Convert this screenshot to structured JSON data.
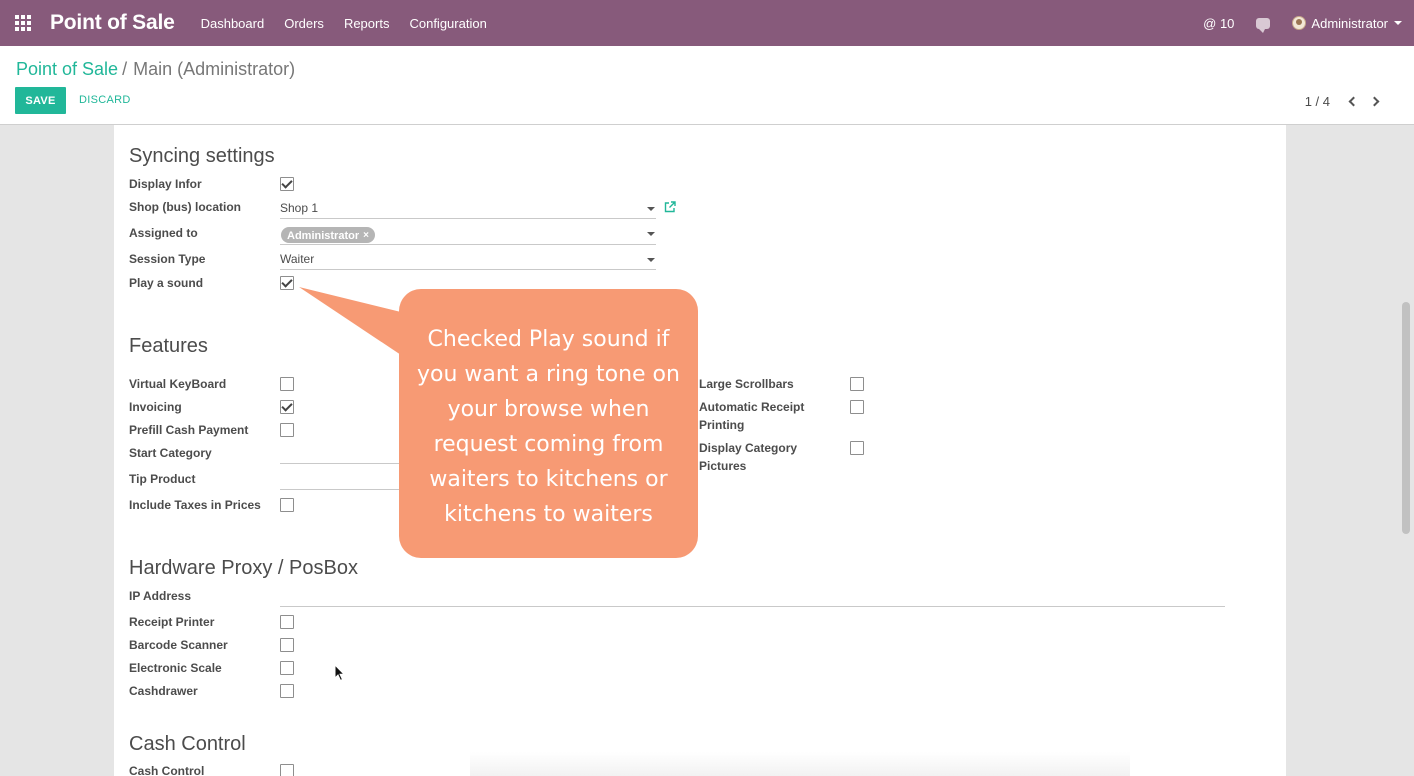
{
  "navbar": {
    "app_title": "Point of Sale",
    "menu": [
      "Dashboard",
      "Orders",
      "Reports",
      "Configuration"
    ],
    "mentions": "@ 10",
    "user": "Administrator",
    "color": "#875a7b"
  },
  "control_panel": {
    "breadcrumb_root": "Point of Sale",
    "breadcrumb_sep": "/",
    "breadcrumb_current": "Main (Administrator)",
    "save_label": "SAVE",
    "discard_label": "DISCARD",
    "pager_value": "1 / 4",
    "accent": "#21b799"
  },
  "syncing": {
    "title": "Syncing settings",
    "display_infor": {
      "label": "Display Infor",
      "checked": true
    },
    "shop_location": {
      "label": "Shop (bus) location",
      "value": "Shop 1"
    },
    "assigned_to": {
      "label": "Assigned to",
      "tag": "Administrator",
      "tag_remove": "×"
    },
    "session_type": {
      "label": "Session Type",
      "value": "Waiter"
    },
    "play_sound": {
      "label": "Play a sound",
      "checked": true
    }
  },
  "features": {
    "title": "Features",
    "virtual_keyboard": {
      "label": "Virtual KeyBoard",
      "checked": false
    },
    "invoicing": {
      "label": "Invoicing",
      "checked": true
    },
    "prefill_cash": {
      "label": "Prefill Cash Payment",
      "checked": false
    },
    "start_category": {
      "label": "Start Category"
    },
    "tip_product": {
      "label": "Tip Product"
    },
    "include_taxes": {
      "label": "Include Taxes in Prices",
      "checked": false
    },
    "large_scrollbars": {
      "label": "Large Scrollbars",
      "checked": false
    },
    "auto_receipt": {
      "label_line1": "Automatic Receipt",
      "label_line2": "Printing",
      "checked": false
    },
    "display_category_pictures": {
      "label_line1": "Display Category",
      "label_line2": "Pictures",
      "checked": false
    }
  },
  "hardware": {
    "title": "Hardware Proxy / PosBox",
    "ip_address": {
      "label": "IP Address"
    },
    "receipt_printer": {
      "label": "Receipt Printer",
      "checked": false
    },
    "barcode_scanner": {
      "label": "Barcode Scanner",
      "checked": false
    },
    "electronic_scale": {
      "label": "Electronic Scale",
      "checked": false
    },
    "cashdrawer": {
      "label": "Cashdrawer",
      "checked": false
    }
  },
  "cash_control": {
    "title": "Cash Control",
    "cash_control_field": {
      "label": "Cash Control",
      "checked": false
    }
  },
  "callout": {
    "lines": [
      "Checked Play sound if",
      "you want a ring tone on",
      "your browse when",
      "request coming from",
      "waiters to kitchens or",
      "kitchens to waiters"
    ],
    "color": "#f79a74"
  }
}
